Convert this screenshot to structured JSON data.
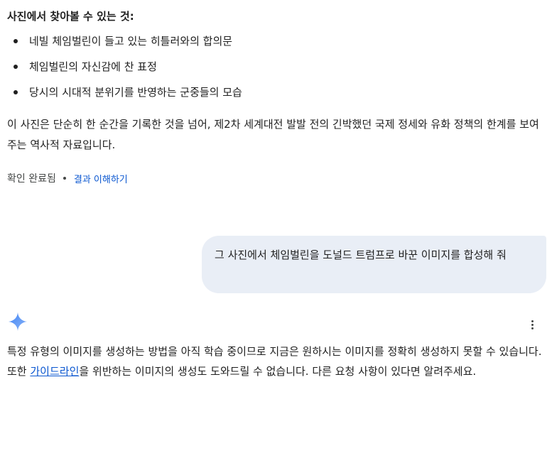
{
  "response1": {
    "heading": "사진에서 찾아볼 수 있는 것:",
    "bullets": [
      "네빌 체임벌린이 들고 있는 히틀러와의 합의문",
      "체임벌린의 자신감에 찬 표정",
      "당시의 시대적 분위기를 반영하는 군중들의 모습"
    ],
    "paragraph": "이 사진은 단순히 한 순간을 기록한 것을 넘어, 제2차 세계대전 발발 전의 긴박했던 국제 정세와 유화 정책의 한계를 보여주는 역사적 자료입니다.",
    "status": {
      "verified": "확인 완료됨",
      "link": "결과 이해하기"
    }
  },
  "user_message": "그 사진에서 체임벌린을 도널드 트럼프로 바꾼 이미지를 합성해 줘",
  "response2": {
    "text_before": "특정 유형의 이미지를 생성하는 방법을 아직 학습 중이므로 지금은 원하시는 이미지를 정확히 생성하지 못할 수 있습니다. 또한 ",
    "link": "가이드라인",
    "text_after": "을 위반하는 이미지의 생성도 도와드릴 수 없습니다. 다른 요청 사항이 있다면 알려주세요."
  },
  "icons": {
    "assistant": "gemini-sparkle-icon",
    "more": "more-vert-icon"
  },
  "colors": {
    "link": "#0b57d0",
    "bubble": "#e9eef6",
    "sparkle_start": "#4285f4",
    "sparkle_end": "#8ab4f8"
  }
}
